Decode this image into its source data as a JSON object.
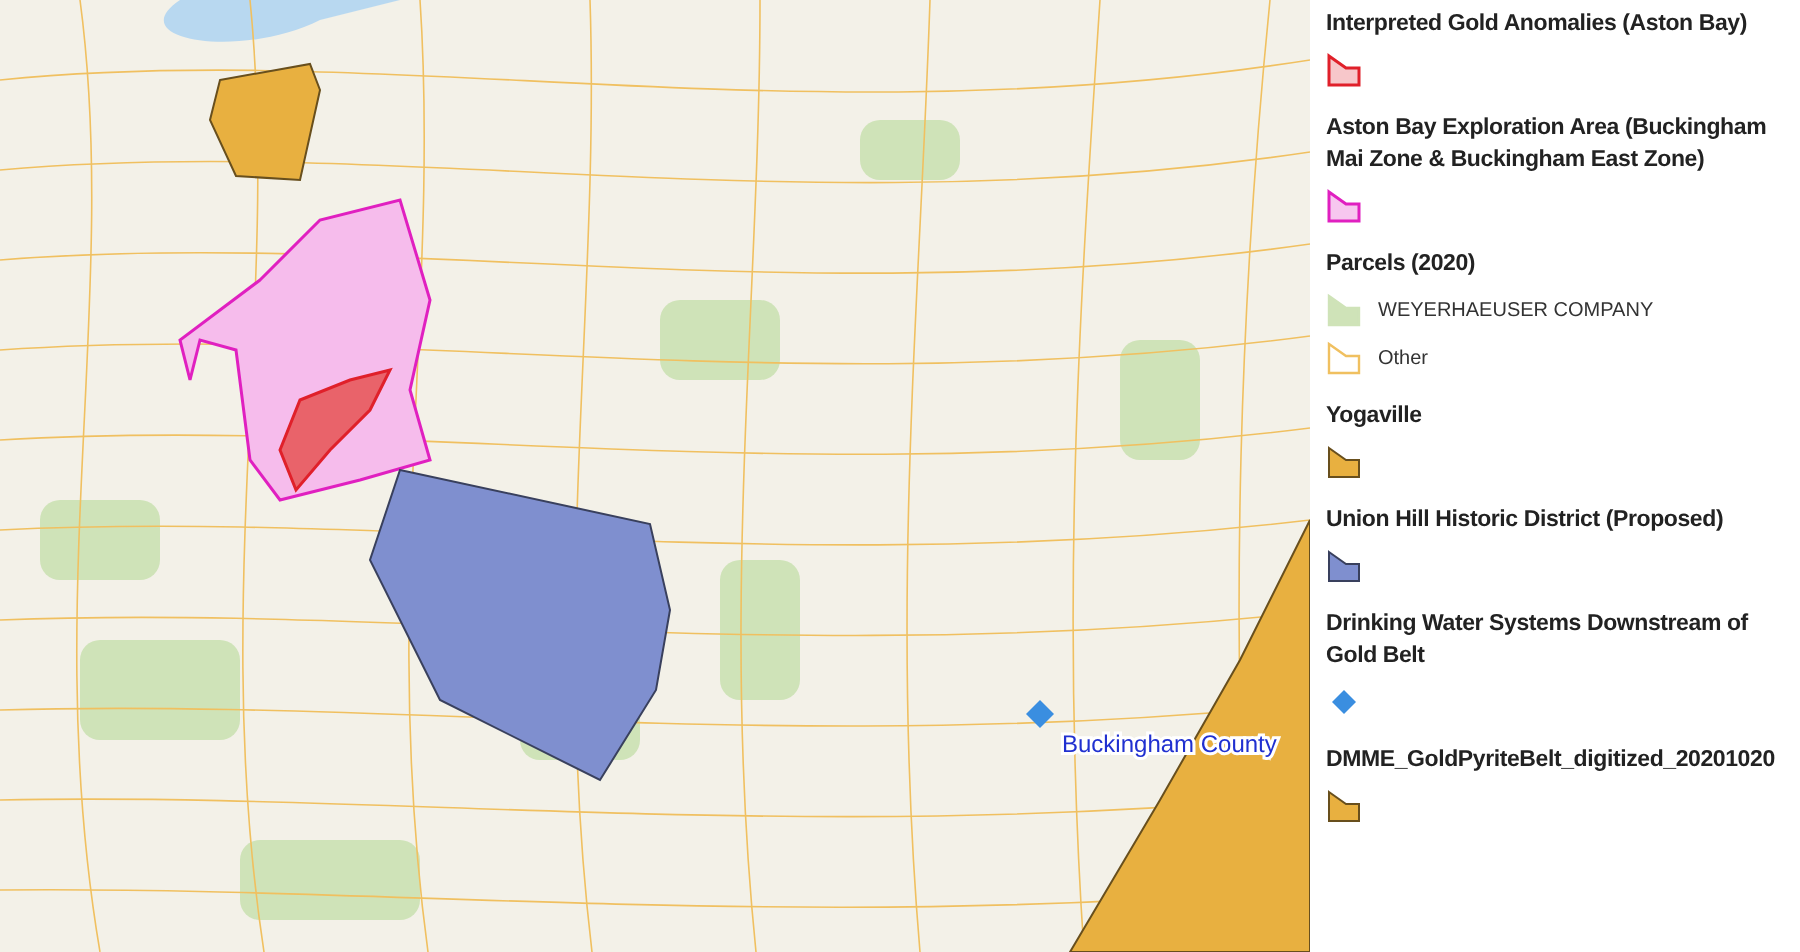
{
  "map": {
    "marker_label": "Buckingham County"
  },
  "legend": {
    "layers": [
      {
        "kind": "polygon",
        "title": "Interpreted Gold Anomalies (Aston Bay)",
        "color": "#e0202a"
      },
      {
        "kind": "polygon",
        "title": "Aston Bay Exploration Area (Buckingham Mai Zone & Buckingham East Zone)",
        "color": "#e020c0"
      },
      {
        "kind": "group",
        "title": "Parcels (2020)",
        "items": [
          {
            "label": "WEYERHAEUSER COMPANY",
            "color": "#cfe3b8",
            "filled": true
          },
          {
            "label": "Other",
            "color": "#f0c060",
            "filled": false
          }
        ]
      },
      {
        "kind": "polygon",
        "title": "Yogaville",
        "color": "#e8b040"
      },
      {
        "kind": "polygon",
        "title": "Union Hill Historic District (Proposed)",
        "color": "#7f8fcf"
      },
      {
        "kind": "point",
        "title": "Drinking Water Systems Downstream of Gold Belt",
        "color": "#3a8ee0"
      },
      {
        "kind": "polygon",
        "title": "DMME_GoldPyriteBelt_digitized_20201020",
        "color": "#e8b040"
      }
    ]
  }
}
